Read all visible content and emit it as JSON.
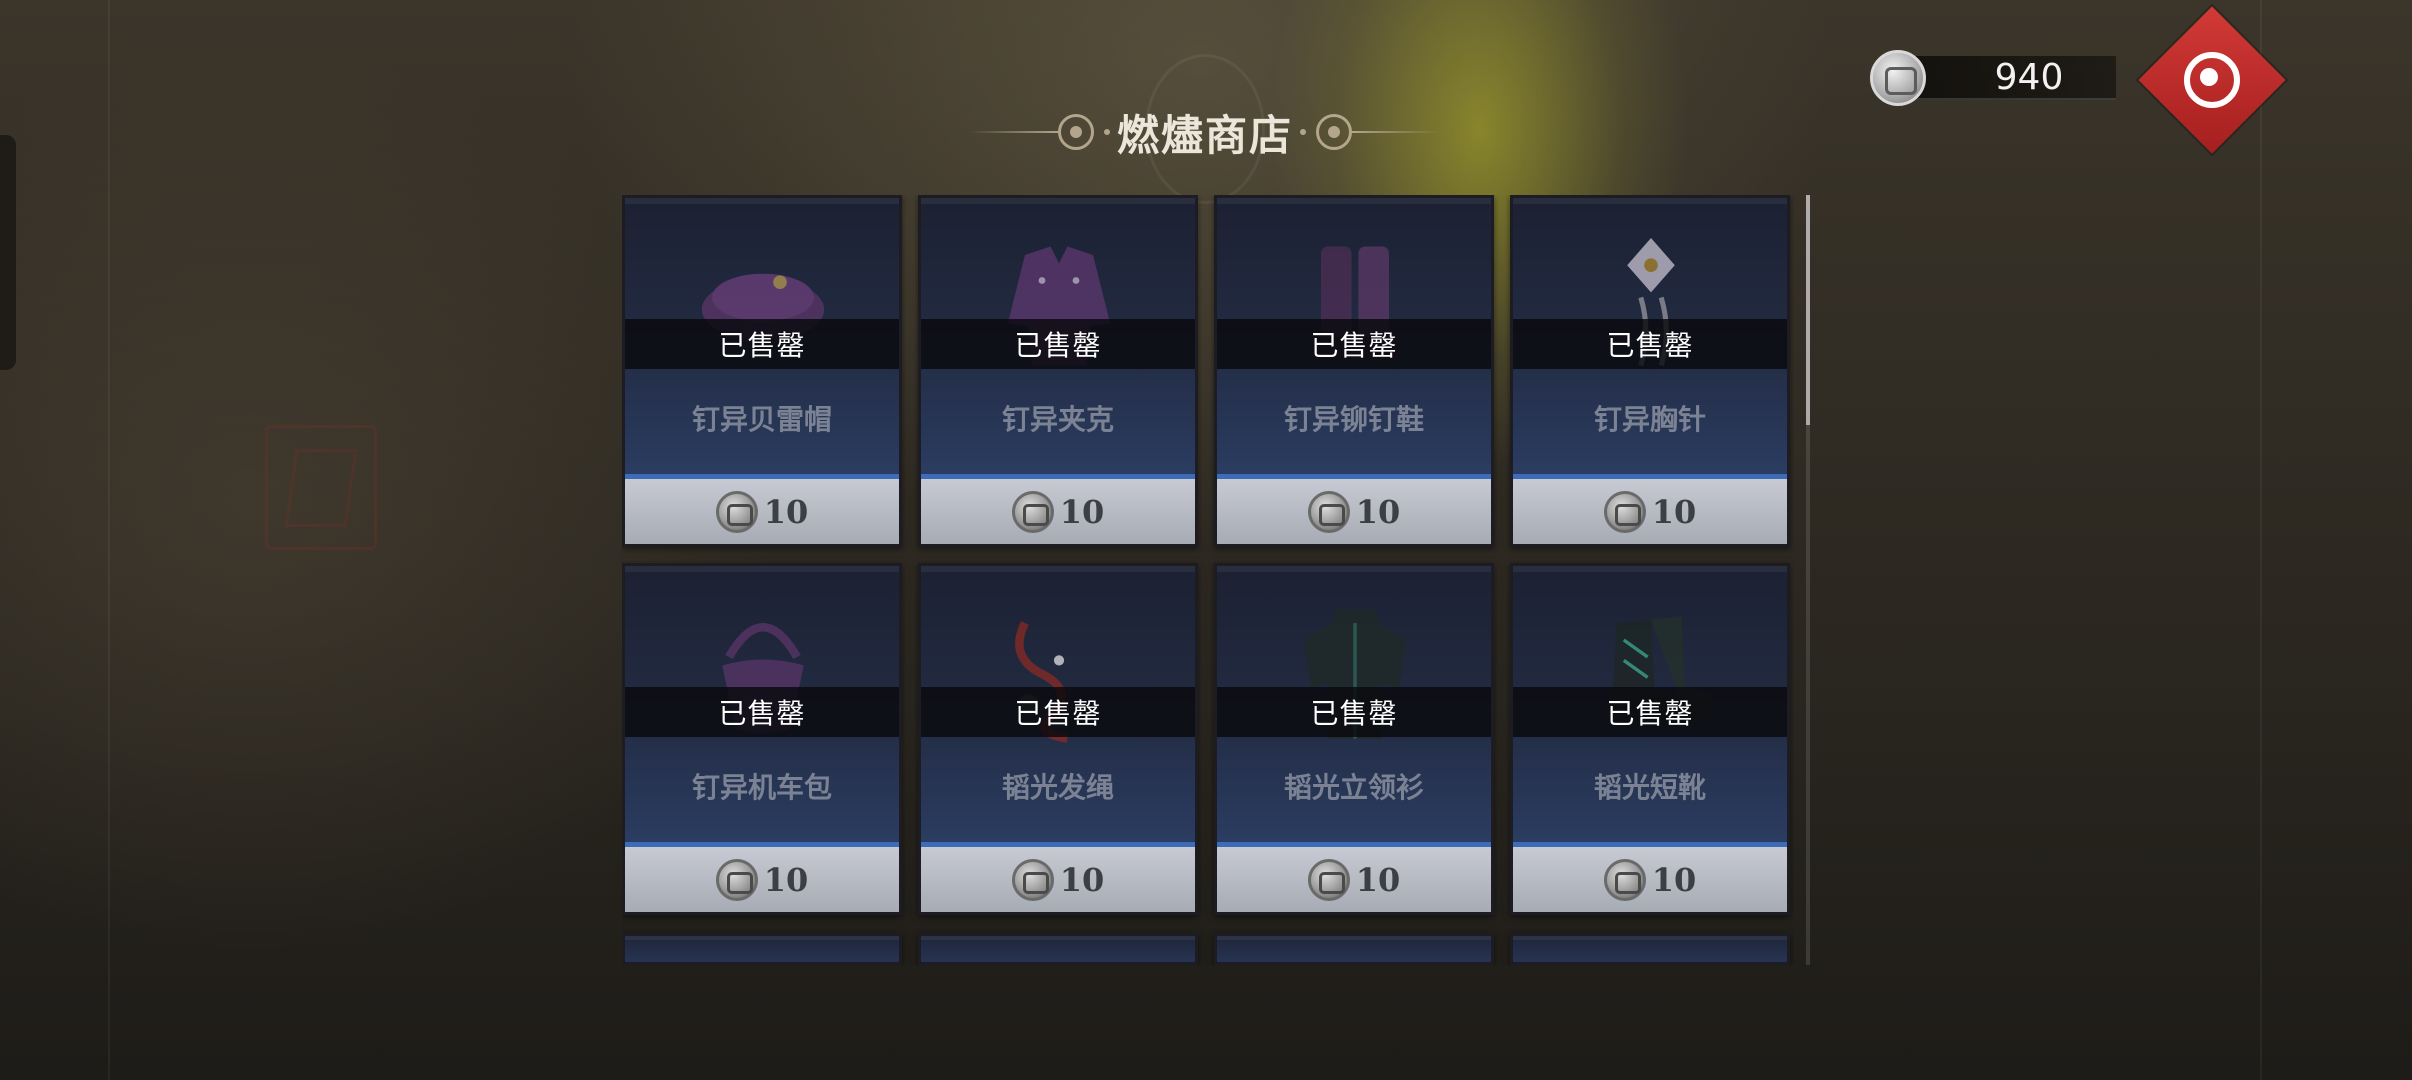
{
  "shop": {
    "title": "燃燼商店"
  },
  "currency": {
    "amount": "940",
    "icon": "silver-coin-icon"
  },
  "emblem": {
    "icon": "red-diamond-emblem-icon",
    "color": "#c72e2b"
  },
  "items": [
    {
      "name": "钉异贝雷帽",
      "status": "已售罄",
      "price": "10",
      "icon": "beret-icon"
    },
    {
      "name": "钉异夹克",
      "status": "已售罄",
      "price": "10",
      "icon": "jacket-icon"
    },
    {
      "name": "钉异铆钉鞋",
      "status": "已售罄",
      "price": "10",
      "icon": "studded-boots-icon"
    },
    {
      "name": "钉异胸针",
      "status": "已售罄",
      "price": "10",
      "icon": "brooch-icon"
    },
    {
      "name": "钉异机车包",
      "status": "已售罄",
      "price": "10",
      "icon": "motorcycle-bag-icon"
    },
    {
      "name": "韬光发绳",
      "status": "已售罄",
      "price": "10",
      "icon": "hair-cord-icon"
    },
    {
      "name": "韬光立领衫",
      "status": "已售罄",
      "price": "10",
      "icon": "standing-collar-shirt-icon"
    },
    {
      "name": "韬光短靴",
      "status": "已售罄",
      "price": "10",
      "icon": "short-boots-icon"
    }
  ],
  "colors": {
    "card_bg": "#232c44",
    "price_accent": "#3d6bb8",
    "title_text": "#ece6da"
  }
}
